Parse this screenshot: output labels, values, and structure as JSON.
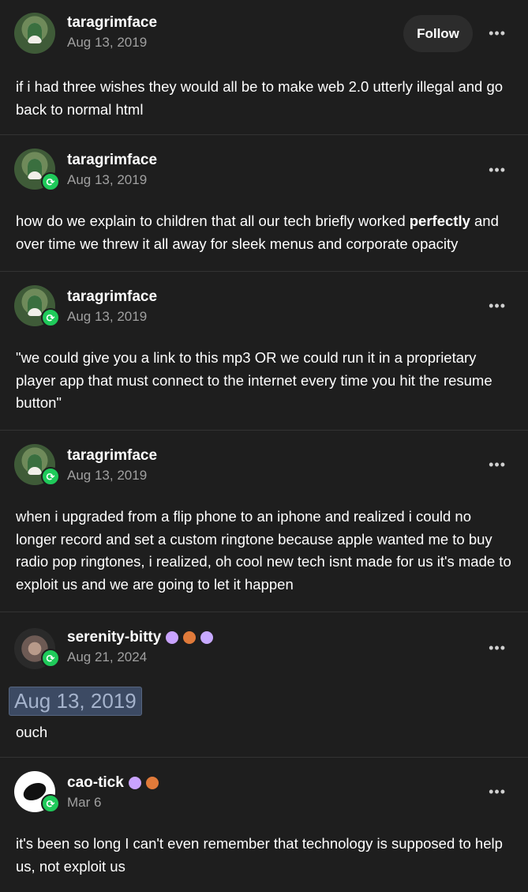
{
  "posts": [
    {
      "user": "taragrimface",
      "date": "Aug 13, 2019",
      "follow": "Follow",
      "more": "•••",
      "text": "if i had three wishes they would all be to make web 2.0 utterly illegal and go back to normal html"
    },
    {
      "user": "taragrimface",
      "date": "Aug 13, 2019",
      "more": "•••",
      "text_a": "how do we explain to children that all our tech briefly worked ",
      "text_b": "perfectly",
      "text_c": " and over time we threw it all away for sleek menus and corporate opacity"
    },
    {
      "user": "taragrimface",
      "date": "Aug 13, 2019",
      "more": "•••",
      "text": "\"we could give you a link to this mp3 OR we could run it in a proprietary player app that must connect to the internet every time you hit the resume button\""
    },
    {
      "user": "taragrimface",
      "date": "Aug 13, 2019",
      "more": "•••",
      "text": "when i upgraded from a flip phone to an iphone and realized i could no longer record and set a custom ringtone because apple wanted me to buy radio pop ringtones, i realized, oh cool new tech isnt made for us it's made to exploit us and we are going to let it happen"
    },
    {
      "user": "serenity-bitty",
      "date": "Aug 21, 2024",
      "more": "•••",
      "quoted_date": "Aug 13, 2019",
      "text": "ouch"
    },
    {
      "user": "cao-tick",
      "date": "Mar 6",
      "more": "•••",
      "text": "it's been so long I can't even remember that technology is supposed to help us, not exploit us"
    }
  ],
  "icons": {
    "reblog": "reblog-icon",
    "more": "more-dots-icon"
  },
  "colors": {
    "background": "#1e1e1e",
    "reblog": "#1fca5a",
    "date": "#a0a0a0"
  }
}
